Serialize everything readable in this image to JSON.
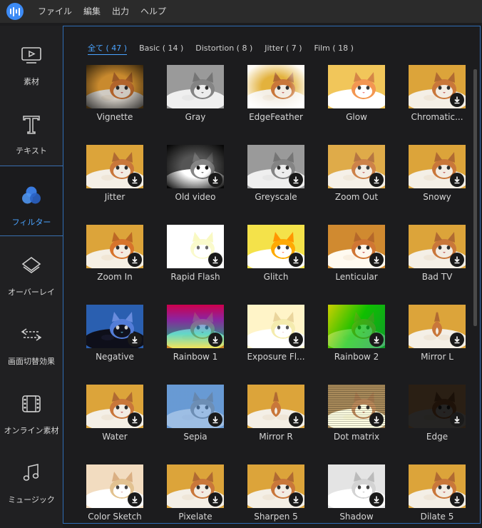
{
  "menubar": {
    "items": [
      "ファイル",
      "編集",
      "出力",
      "ヘルプ"
    ],
    "logo_icon": "app-logo-icon"
  },
  "sidebar": {
    "items": [
      {
        "label": "素材",
        "icon": "media-icon"
      },
      {
        "label": "テキスト",
        "icon": "text-icon"
      },
      {
        "label": "フィルター",
        "icon": "filter-icon",
        "active": true
      },
      {
        "label": "オーバーレイ",
        "icon": "overlay-icon"
      },
      {
        "label": "画面切替効果",
        "icon": "transition-icon"
      },
      {
        "label": "オンライン素材",
        "icon": "film-icon"
      },
      {
        "label": "ミュージック",
        "icon": "music-icon"
      }
    ]
  },
  "tabs": [
    {
      "label": "全て ( 47 )",
      "active": true
    },
    {
      "label": "Basic ( 14 )"
    },
    {
      "label": "Distortion ( 8 )"
    },
    {
      "label": "Jitter ( 7 )"
    },
    {
      "label": "Film ( 18 )"
    }
  ],
  "filters": [
    {
      "label": "Vignette",
      "style": "vignette",
      "download": false
    },
    {
      "label": "Gray",
      "style": "gray",
      "download": false
    },
    {
      "label": "EdgeFeather",
      "style": "feather",
      "download": false
    },
    {
      "label": "Glow",
      "style": "glow",
      "download": false
    },
    {
      "label": "Chromatic...",
      "style": "normal",
      "download": true
    },
    {
      "label": "Jitter",
      "style": "normal",
      "download": true
    },
    {
      "label": "Old video",
      "style": "oldvideo",
      "download": true
    },
    {
      "label": "Greyscale",
      "style": "gray",
      "download": true
    },
    {
      "label": "Zoom Out",
      "style": "zoomout",
      "download": true
    },
    {
      "label": "Snowy",
      "style": "normal",
      "download": true
    },
    {
      "label": "Zoom In",
      "style": "zoomin",
      "download": true
    },
    {
      "label": "Rapid Flash",
      "style": "flash",
      "download": true
    },
    {
      "label": "Glitch",
      "style": "glitch",
      "download": true
    },
    {
      "label": "Lenticular",
      "style": "lenticular",
      "download": true
    },
    {
      "label": "Bad TV",
      "style": "normal",
      "download": true
    },
    {
      "label": "Negative",
      "style": "negative",
      "download": true
    },
    {
      "label": "Rainbow 1",
      "style": "rainbow1",
      "download": true
    },
    {
      "label": "Exposure Fl...",
      "style": "exposure",
      "download": true
    },
    {
      "label": "Rainbow 2",
      "style": "rainbow2",
      "download": true
    },
    {
      "label": "Mirror L",
      "style": "mirror",
      "download": true
    },
    {
      "label": "Water",
      "style": "normal",
      "download": true
    },
    {
      "label": "Sepia",
      "style": "sepia",
      "download": true
    },
    {
      "label": "Mirror R",
      "style": "mirror",
      "download": true
    },
    {
      "label": "Dot matrix",
      "style": "dots",
      "download": true
    },
    {
      "label": "Edge",
      "style": "edge",
      "download": true
    },
    {
      "label": "Color Sketch",
      "style": "sketch",
      "download": true
    },
    {
      "label": "Pixelate",
      "style": "normal",
      "download": true
    },
    {
      "label": "Sharpen 5",
      "style": "normal",
      "download": true
    },
    {
      "label": "Shadow",
      "style": "shadow",
      "download": true
    },
    {
      "label": "Dilate 5",
      "style": "normal",
      "download": true
    }
  ],
  "colors": {
    "accent": "#4aa3ff",
    "panel_border": "#2f6db5",
    "background": "#1c1c1e"
  }
}
